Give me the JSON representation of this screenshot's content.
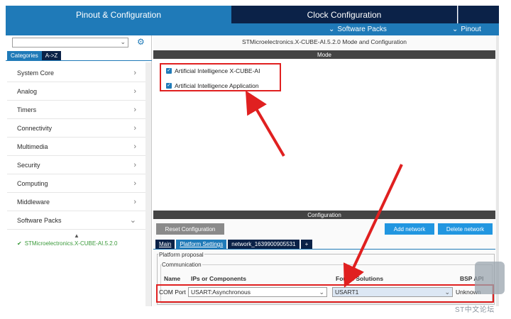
{
  "tabs": {
    "pinout": "Pinout & Configuration",
    "clock": "Clock Configuration"
  },
  "subbar": {
    "software_packs": "Software Packs",
    "pinout": "Pinout"
  },
  "left": {
    "search_placeholder": "",
    "category_tabs": [
      "Categories",
      "A->Z"
    ],
    "categories": [
      {
        "label": "System Core",
        "chevron": "›"
      },
      {
        "label": "Analog",
        "chevron": "›"
      },
      {
        "label": "Timers",
        "chevron": "›"
      },
      {
        "label": "Connectivity",
        "chevron": "›"
      },
      {
        "label": "Multimedia",
        "chevron": "›"
      },
      {
        "label": "Security",
        "chevron": "›"
      },
      {
        "label": "Computing",
        "chevron": "›"
      },
      {
        "label": "Middleware",
        "chevron": "›"
      },
      {
        "label": "Software Packs",
        "chevron": "⌄"
      }
    ],
    "sort_icon": "▲",
    "pack_check": "✔",
    "pack_name": "STMicroelectronics.X-CUBE-AI.5.2.0"
  },
  "mode": {
    "title": "STMicroelectronics.X-CUBE-AI.5.2.0 Mode and Configuration",
    "header": "Mode",
    "checks": [
      {
        "label": "Artificial Intelligence X-CUBE-AI",
        "checked": true
      },
      {
        "label": "Artificial Intelligence Application",
        "checked": true
      }
    ]
  },
  "config": {
    "header": "Configuration",
    "reset_button": "Reset Configuration",
    "add_network_button": "Add network",
    "delete_network_button": "Delete network",
    "tabs": [
      "Main",
      "Platform Settings",
      "network_1639900905531",
      "+"
    ],
    "platform_legend": "Platform proposal",
    "comm_legend": "Communication",
    "columns": [
      "Name",
      "IPs or Components",
      "Found Solutions",
      "BSP API"
    ],
    "row": {
      "name": "COM Port",
      "ip": "USART:Asynchronous",
      "found": "USART1",
      "bsp": "Unknown"
    }
  },
  "watermark": "ST中文论坛",
  "colors": {
    "accent_blue": "#1f7ab8",
    "dark_navy": "#0b2248",
    "highlight_red": "#e02020",
    "button_blue": "#2196e0",
    "pack_green": "#3a9a3a"
  },
  "icons": {
    "gear": "gear-icon",
    "chevron": "chevron-right-icon",
    "check": "checkbox-checked-icon"
  }
}
